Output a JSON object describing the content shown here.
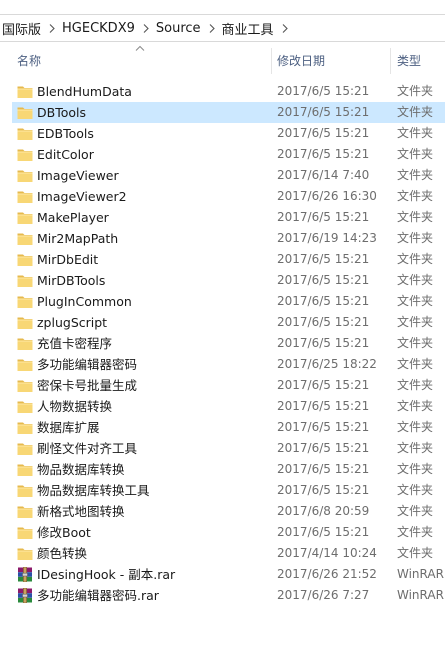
{
  "breadcrumb": [
    "国际版",
    "HGECKDX9",
    "Source",
    "商业工具"
  ],
  "columns": {
    "name": "名称",
    "date": "修改日期",
    "type": "类型"
  },
  "colors": {
    "folder": "#f8d775",
    "folder_dark": "#e6b94d",
    "selected": "#cce8ff",
    "header_text": "#4d6082"
  },
  "files": [
    {
      "name": "BlendHumData",
      "date": "2017/6/5 15:21",
      "type": "文件夹",
      "icon": "folder-icon"
    },
    {
      "name": "DBTools",
      "date": "2017/6/5 15:21",
      "type": "文件夹",
      "icon": "folder-icon",
      "selected": true
    },
    {
      "name": "EDBTools",
      "date": "2017/6/5 15:21",
      "type": "文件夹",
      "icon": "folder-icon"
    },
    {
      "name": "EditColor",
      "date": "2017/6/5 15:21",
      "type": "文件夹",
      "icon": "folder-icon"
    },
    {
      "name": "ImageViewer",
      "date": "2017/6/14 7:40",
      "type": "文件夹",
      "icon": "folder-icon"
    },
    {
      "name": "ImageViewer2",
      "date": "2017/6/26 16:30",
      "type": "文件夹",
      "icon": "folder-icon"
    },
    {
      "name": "MakePlayer",
      "date": "2017/6/5 15:21",
      "type": "文件夹",
      "icon": "folder-icon"
    },
    {
      "name": "Mir2MapPath",
      "date": "2017/6/19 14:23",
      "type": "文件夹",
      "icon": "folder-icon"
    },
    {
      "name": "MirDbEdit",
      "date": "2017/6/5 15:21",
      "type": "文件夹",
      "icon": "folder-icon"
    },
    {
      "name": "MirDBTools",
      "date": "2017/6/5 15:21",
      "type": "文件夹",
      "icon": "folder-icon"
    },
    {
      "name": "PlugInCommon",
      "date": "2017/6/5 15:21",
      "type": "文件夹",
      "icon": "folder-icon"
    },
    {
      "name": "zplugScript",
      "date": "2017/6/5 15:21",
      "type": "文件夹",
      "icon": "folder-icon"
    },
    {
      "name": "充值卡密程序",
      "date": "2017/6/5 15:21",
      "type": "文件夹",
      "icon": "folder-icon"
    },
    {
      "name": "多功能编辑器密码",
      "date": "2017/6/25 18:22",
      "type": "文件夹",
      "icon": "folder-icon"
    },
    {
      "name": "密保卡号批量生成",
      "date": "2017/6/5 15:21",
      "type": "文件夹",
      "icon": "folder-icon"
    },
    {
      "name": "人物数据转换",
      "date": "2017/6/5 15:21",
      "type": "文件夹",
      "icon": "folder-icon"
    },
    {
      "name": "数据库扩展",
      "date": "2017/6/5 15:21",
      "type": "文件夹",
      "icon": "folder-icon"
    },
    {
      "name": "刷怪文件对齐工具",
      "date": "2017/6/5 15:21",
      "type": "文件夹",
      "icon": "folder-icon"
    },
    {
      "name": "物品数据库转换",
      "date": "2017/6/5 15:21",
      "type": "文件夹",
      "icon": "folder-icon"
    },
    {
      "name": "物品数据库转换工具",
      "date": "2017/6/5 15:21",
      "type": "文件夹",
      "icon": "folder-icon"
    },
    {
      "name": "新格式地图转换",
      "date": "2017/6/8 20:59",
      "type": "文件夹",
      "icon": "folder-icon"
    },
    {
      "name": "修改Boot",
      "date": "2017/6/5 15:21",
      "type": "文件夹",
      "icon": "folder-icon"
    },
    {
      "name": "颜色转换",
      "date": "2017/4/14 10:24",
      "type": "文件夹",
      "icon": "folder-icon"
    },
    {
      "name": "IDesingHook - 副本.rar",
      "date": "2017/6/26 21:52",
      "type": "WinRAR",
      "icon": "winrar-archive-icon"
    },
    {
      "name": "多功能编辑器密码.rar",
      "date": "2017/6/26 7:27",
      "type": "WinRAR",
      "icon": "winrar-archive-icon"
    }
  ]
}
